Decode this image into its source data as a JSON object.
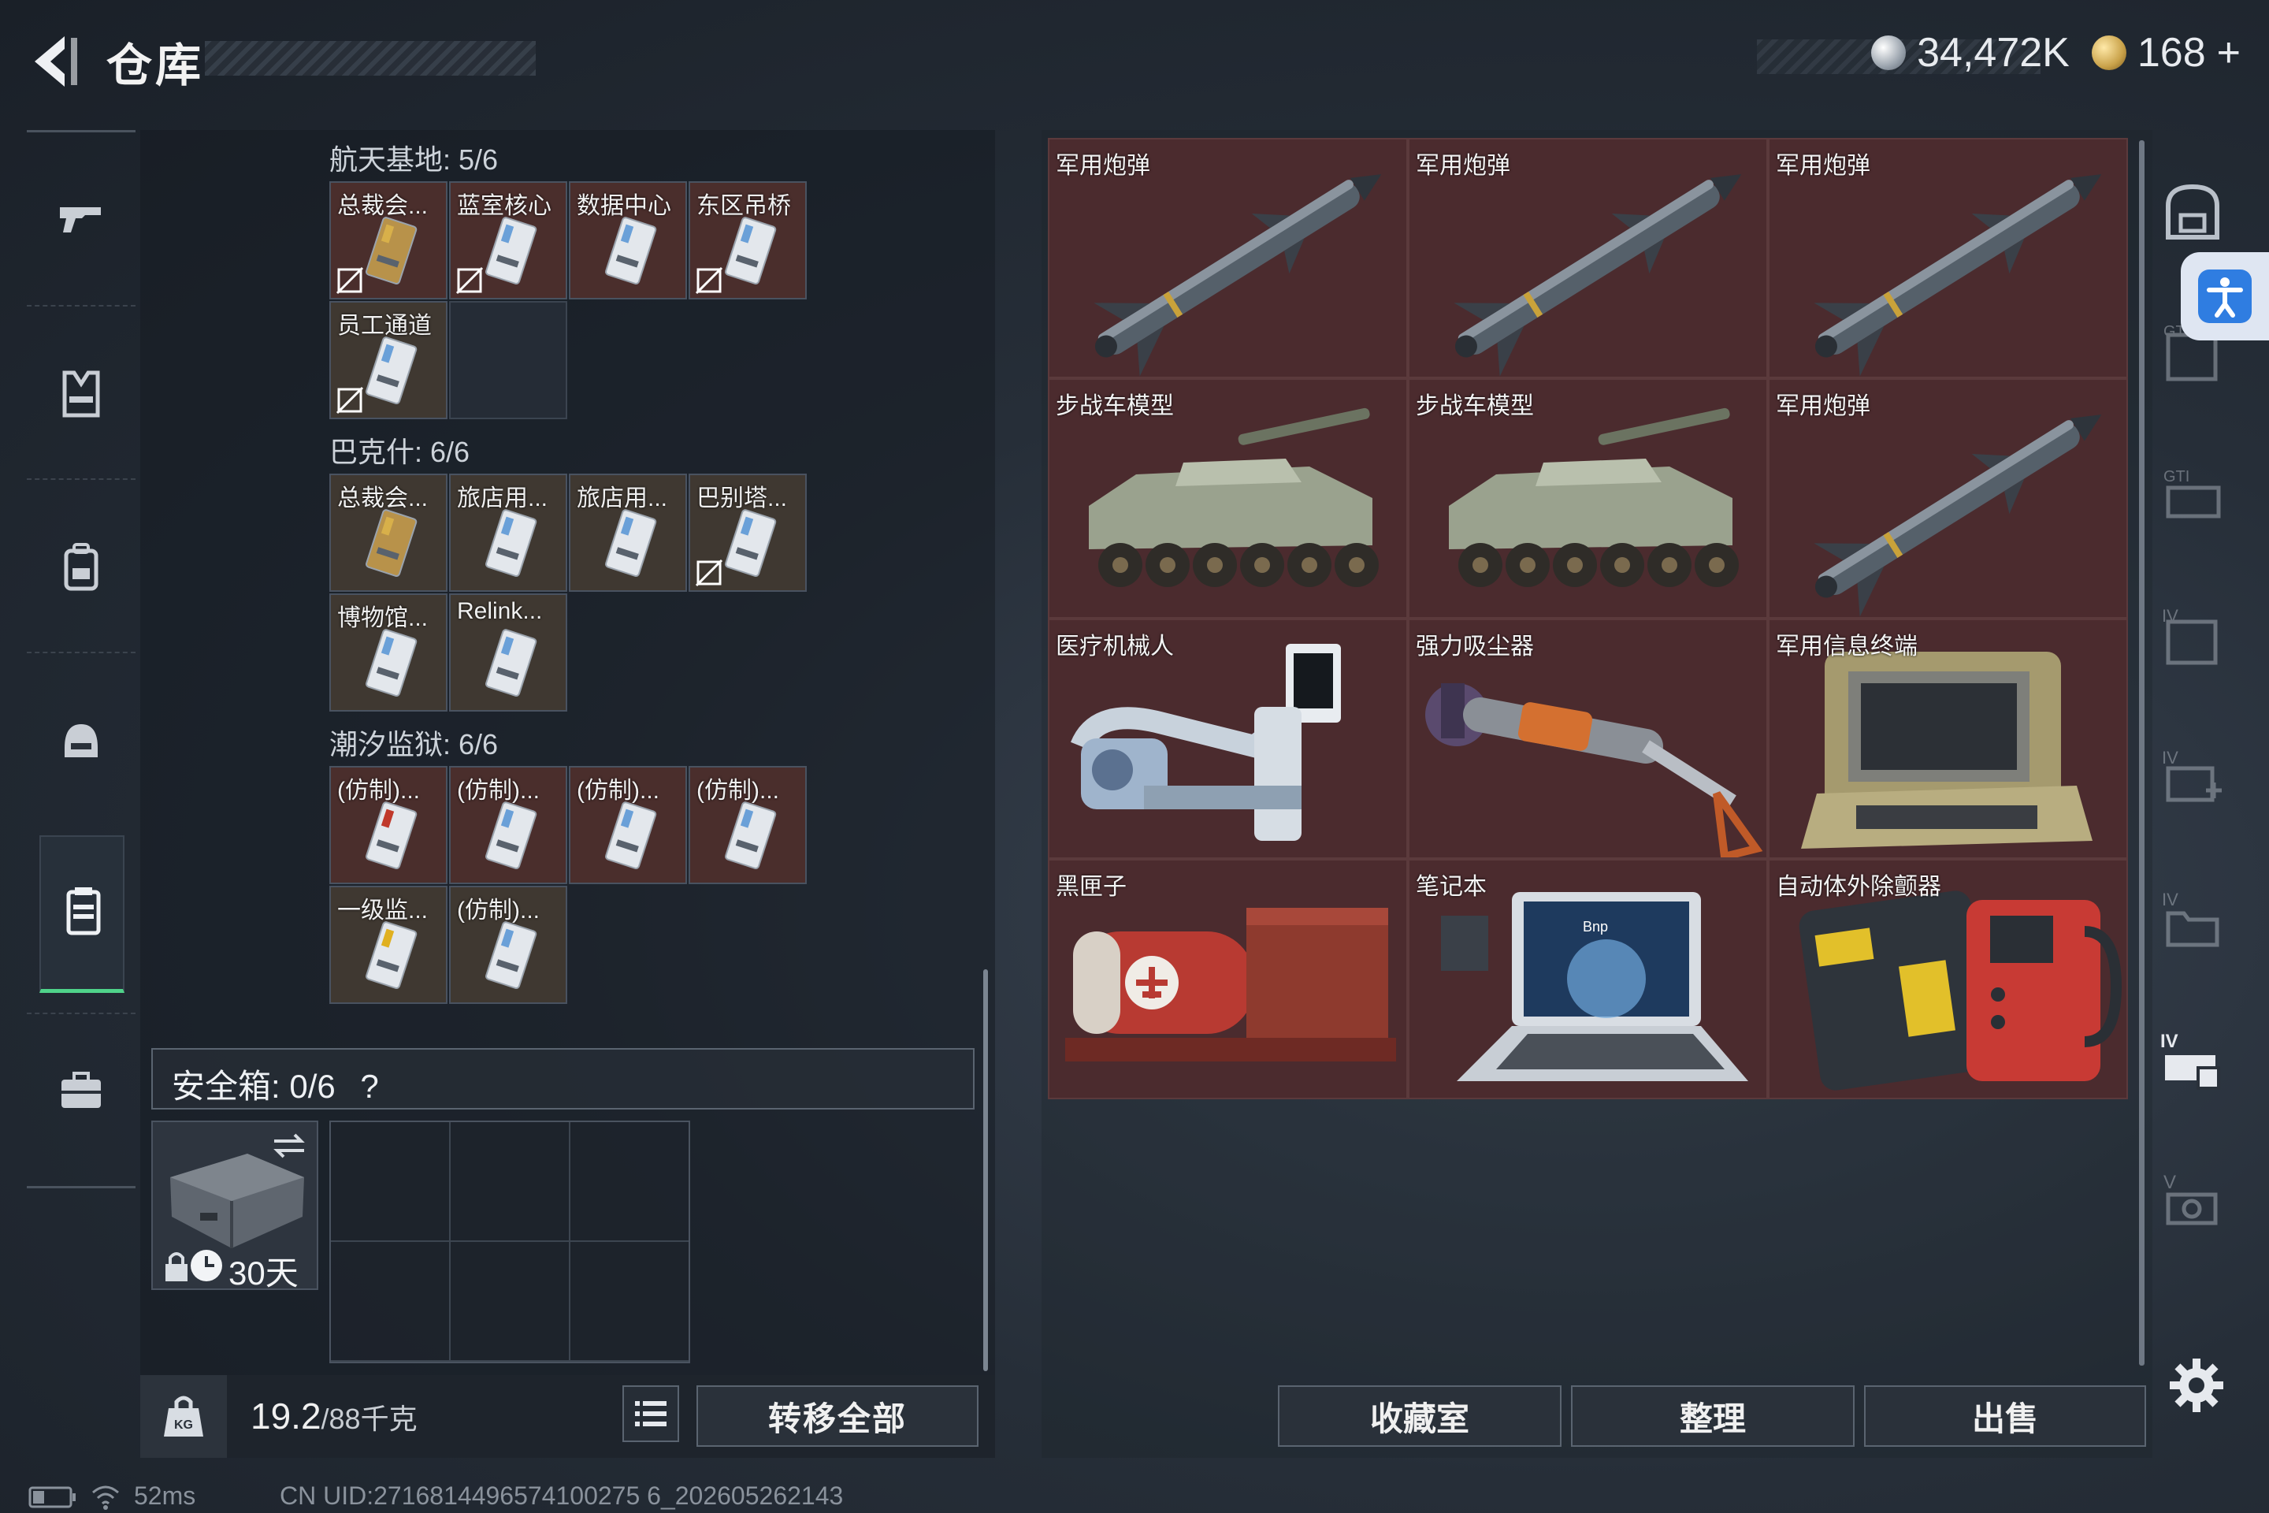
{
  "header": {
    "title": "仓库",
    "currency_a": "34,472K",
    "currency_b": "168",
    "currency_b_plus": "+"
  },
  "left_nav": {
    "items": [
      {
        "name": "weapons",
        "icon": "gun-icon"
      },
      {
        "name": "armor",
        "icon": "vest-icon"
      },
      {
        "name": "backpack",
        "icon": "backpack-icon"
      },
      {
        "name": "helmet",
        "icon": "helmet-icon"
      },
      {
        "name": "keycards",
        "icon": "keycard-case-icon",
        "active": true
      },
      {
        "name": "cases",
        "icon": "briefcase-icon"
      }
    ]
  },
  "key_groups": [
    {
      "title": "航天基地: 5/6",
      "cards": [
        "总裁会...",
        "蓝室核心",
        "数据中心",
        "东区吊桥",
        "员工通道"
      ]
    },
    {
      "title": "巴克什: 6/6",
      "cards": [
        "总裁会...",
        "旅店用...",
        "旅店用...",
        "巴别塔...",
        "博物馆...",
        "Relink..."
      ]
    },
    {
      "title": "潮汐监狱: 6/6",
      "cards": [
        "(仿制)...",
        "(仿制)...",
        "(仿制)...",
        "(仿制)...",
        "一级监...",
        "(仿制)..."
      ]
    }
  ],
  "safe_box": {
    "label": "安全箱:  0/6",
    "help": "?",
    "timer": "30天"
  },
  "weight": {
    "current": "19.2",
    "max": "/88千克"
  },
  "buttons": {
    "transfer_all": "转移全部",
    "collection": "收藏室",
    "sort": "整理",
    "sell": "出售"
  },
  "items": [
    {
      "label": "军用炮弹",
      "type": "missile"
    },
    {
      "label": "军用炮弹",
      "type": "missile"
    },
    {
      "label": "军用炮弹",
      "type": "missile"
    },
    {
      "label": "步战车模型",
      "type": "apc"
    },
    {
      "label": "步战车模型",
      "type": "apc"
    },
    {
      "label": "军用炮弹",
      "type": "missile"
    },
    {
      "label": "医疗机械人",
      "type": "robot"
    },
    {
      "label": "强力吸尘器",
      "type": "vacuum"
    },
    {
      "label": "军用信息终端",
      "type": "terminal"
    },
    {
      "label": "黑匣子",
      "type": "blackbox"
    },
    {
      "label": "笔记本",
      "type": "laptop"
    },
    {
      "label": "自动体外除颤器",
      "type": "aed"
    }
  ],
  "status": {
    "ping": "52ms",
    "uid": "CN UID:2716814496574100275 6_202605262143"
  },
  "colors": {
    "item_bg": "#4b2b2e",
    "active_tab": "#4fd38a",
    "access_button": "#2f7de1"
  }
}
